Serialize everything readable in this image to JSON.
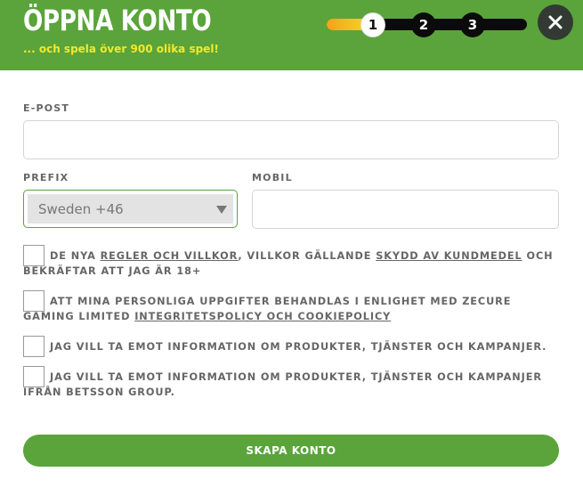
{
  "header": {
    "title": "ÖPPNA KONTO",
    "subtitle": "... och spela över 900 olika spel!",
    "steps": [
      "1",
      "2",
      "3"
    ],
    "active_step": 1,
    "progress_fraction": 0.25,
    "close_icon": "close-icon"
  },
  "form": {
    "email_label": "E-POST",
    "email_value": "",
    "prefix_label": "PREFIX",
    "prefix_value": "Sweden +46",
    "mobile_label": "MOBIL",
    "mobile_value": ""
  },
  "consents": {
    "terms": {
      "pre": "DE NYA ",
      "link1": "REGLER OCH VILLKOR",
      "mid": ", VILLKOR GÄLLANDE ",
      "link2": "SKYDD AV KUNDMEDEL",
      "post": " OCH BEKRÄFTAR ATT JAG ÄR 18+"
    },
    "privacy": {
      "pre": "ATT MINA PERSONLIGA UPPGIFTER BEHANDLAS I ENLIGHET MED ZECURE GAMING LIMITED ",
      "link": "INTEGRITETSPOLICY OCH COOKIEPOLICY"
    },
    "marketing": "JAG VILL TA EMOT INFORMATION OM PRODUKTER, TJÄNSTER OCH KAMPANJER.",
    "marketing_group": "JAG VILL TA EMOT INFORMATION OM PRODUKTER, TJÄNSTER OCH KAMPANJER IFRÅN BETSSON GROUP."
  },
  "submit_label": "SKAPA KONTO",
  "colors": {
    "brand_green": "#5aa43b",
    "subtitle_yellow": "#f5e82a",
    "progress_gradient_start": "#f6a21c",
    "progress_gradient_end": "#f7dd24"
  }
}
